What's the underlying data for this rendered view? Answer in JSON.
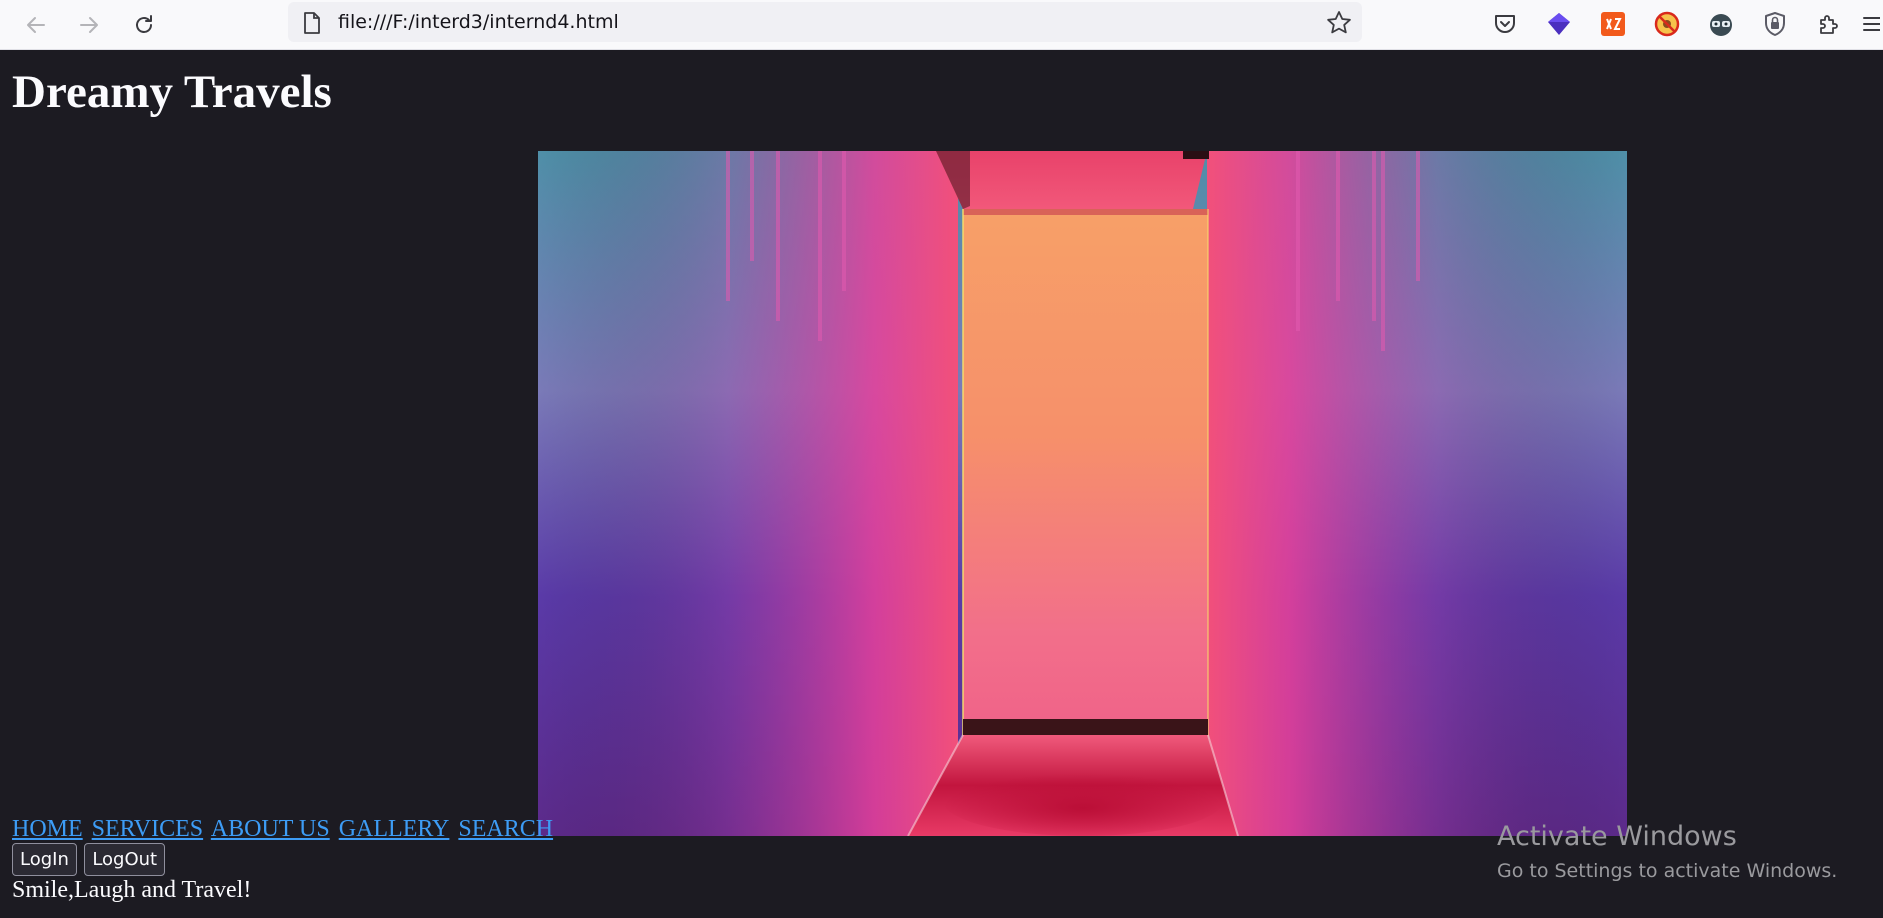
{
  "browser": {
    "url": "file:///F:/interd3/internd4.html",
    "icons": [
      "back-icon",
      "forward-icon",
      "reload-icon",
      "page-icon",
      "bookmark-star-icon",
      "pocket-icon",
      "extension-purple-icon",
      "extension-orange-icon",
      "extension-blocker-icon",
      "extension-spy-icon",
      "shield-icon",
      "extensions-puzzle-icon",
      "menu-icon"
    ]
  },
  "page": {
    "title": "Dreamy Travels",
    "hero_image": "neon-corridor-image",
    "nav": [
      "HOME",
      "SERVICES",
      "ABOUT US",
      "GALLERY",
      "SEARCH"
    ],
    "buttons": {
      "login": "LogIn",
      "logout": "LogOut"
    },
    "tagline": "Smile,Laugh and Travel!"
  },
  "watermark": {
    "title": "Activate Windows",
    "subtitle": "Go to Settings to activate Windows."
  },
  "colors": {
    "page_bg": "#1c1b22",
    "link": "#3d9cf5",
    "text": "#fbfbfe"
  }
}
